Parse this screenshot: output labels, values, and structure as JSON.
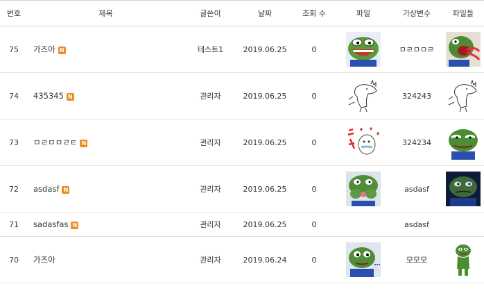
{
  "columns": {
    "no": "번호",
    "subject": "제목",
    "writer": "글쓴이",
    "date": "날짜",
    "views": "조회 수",
    "file": "파일",
    "var": "가상변수",
    "files": "파일들"
  },
  "new_badge": "N",
  "rows": [
    {
      "no": "75",
      "subject": "가즈아",
      "writer": "테스트1",
      "date": "2019.06.25",
      "views": "0",
      "file_icon": "pepe-laughing-icon",
      "var": "ㅁㄹㅁㅁㄹ",
      "files_icon": "pepe-screaming-icon"
    },
    {
      "no": "74",
      "subject": "435345",
      "writer": "관리자",
      "date": "2019.06.25",
      "views": "0",
      "file_icon": "moomin-sketch-icon",
      "var": "324243",
      "files_icon": "moomin-sketch-icon"
    },
    {
      "no": "73",
      "subject": "ㅁㄹㅁㅁㄹㅌ",
      "writer": "관리자",
      "date": "2019.06.25",
      "views": "0",
      "file_icon": "moomin-hearts-icon",
      "var": "324234",
      "files_icon": "pepe-smug-icon"
    },
    {
      "no": "72",
      "subject": "asdasf",
      "writer": "관리자",
      "date": "2019.06.25",
      "views": "0",
      "file_icon": "pepe-hands-face-icon",
      "var": "asdasf",
      "files_icon": "pepe-dark-icon"
    },
    {
      "no": "71",
      "subject": "sadasfas",
      "writer": "관리자",
      "date": "2019.06.25",
      "views": "0",
      "file_icon": "",
      "var": "asdasf",
      "files_icon": ""
    },
    {
      "no": "70",
      "subject": "가즈아",
      "writer": "관리자",
      "date": "2019.06.24",
      "views": "0",
      "file_icon": "pepe-sweating-icon",
      "var": "모모모",
      "files_icon": "pepe-standing-icon"
    }
  ]
}
